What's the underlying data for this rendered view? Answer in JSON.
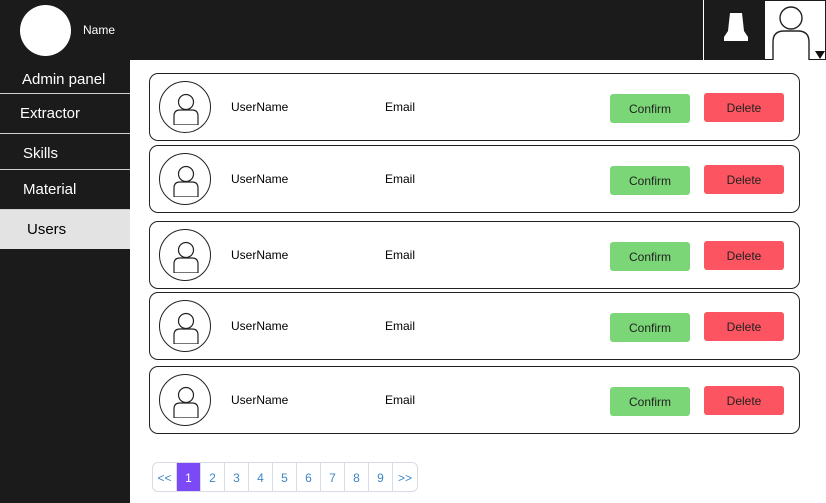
{
  "header": {
    "brand_name": "Name",
    "icons": {
      "brand": "avatar-circle",
      "bell": "bell-icon",
      "profile": "user-icon",
      "caret": "caret-down-icon"
    }
  },
  "sidebar": {
    "title": "Admin panel",
    "items": [
      {
        "label": "Extractor",
        "active": false
      },
      {
        "label": "Skills",
        "active": false
      },
      {
        "label": "Material",
        "active": false
      },
      {
        "label": "Users",
        "active": true
      }
    ]
  },
  "users": [
    {
      "username": "UserName",
      "email": "Email",
      "confirm": "Confirm",
      "delete": "Delete"
    },
    {
      "username": "UserName",
      "email": "Email",
      "confirm": "Confirm",
      "delete": "Delete"
    },
    {
      "username": "UserName",
      "email": "Email",
      "confirm": "Confirm",
      "delete": "Delete"
    },
    {
      "username": "UserName",
      "email": "Email",
      "confirm": "Confirm",
      "delete": "Delete"
    },
    {
      "username": "UserName",
      "email": "Email",
      "confirm": "Confirm",
      "delete": "Delete"
    }
  ],
  "pagination": {
    "prev": "<<",
    "pages": [
      "1",
      "2",
      "3",
      "4",
      "5",
      "6",
      "7",
      "8",
      "9"
    ],
    "current": "1",
    "next": ">>"
  },
  "colors": {
    "topbar": "#1b1b1b",
    "confirm": "#7ad676",
    "delete": "#fc5460",
    "active_page": "#7b49f5",
    "sidebar_active": "#e3e3e3"
  }
}
